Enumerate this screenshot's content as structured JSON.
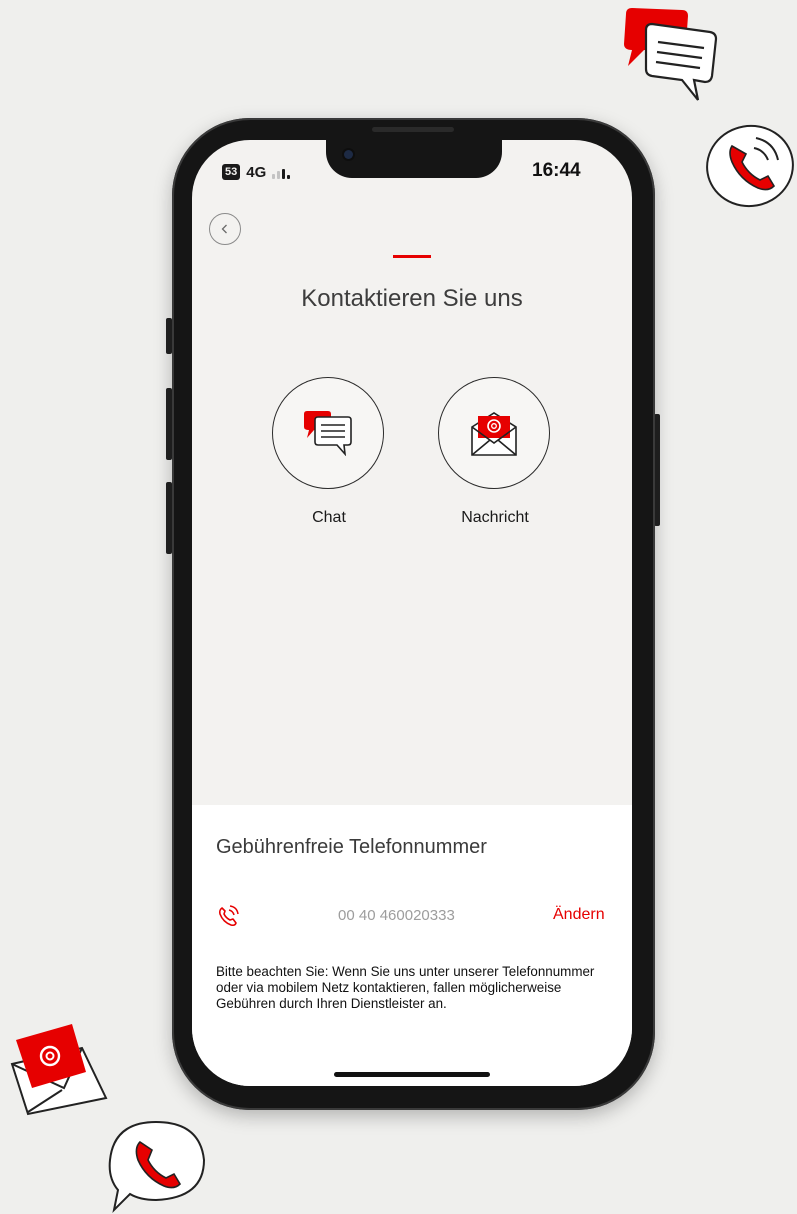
{
  "status_bar": {
    "sim_badge": "53",
    "network": "4G",
    "time": "16:44"
  },
  "header": {
    "back_icon": "chevron-left-icon",
    "title": "Kontaktieren Sie uns"
  },
  "contact_options": [
    {
      "label": "Chat",
      "icon": "chat-bubbles-icon"
    },
    {
      "label": "Nachricht",
      "icon": "envelope-at-icon"
    }
  ],
  "hotline": {
    "title": "Gebührenfreie Telefonnummer",
    "icon": "phone-call-icon",
    "number": "00 40 460020333",
    "change_label": "Ändern",
    "notice": "Bitte beachten Sie: Wenn Sie uns unter unserer Telefonnummer oder via mobilem Netz kontaktieren, fallen möglicherweise Gebühren durch Ihren Dienstleister an."
  },
  "colors": {
    "accent": "#e60000",
    "background": "#efefed",
    "screen_background": "#f3f2f0",
    "panel": "#ffffff"
  }
}
